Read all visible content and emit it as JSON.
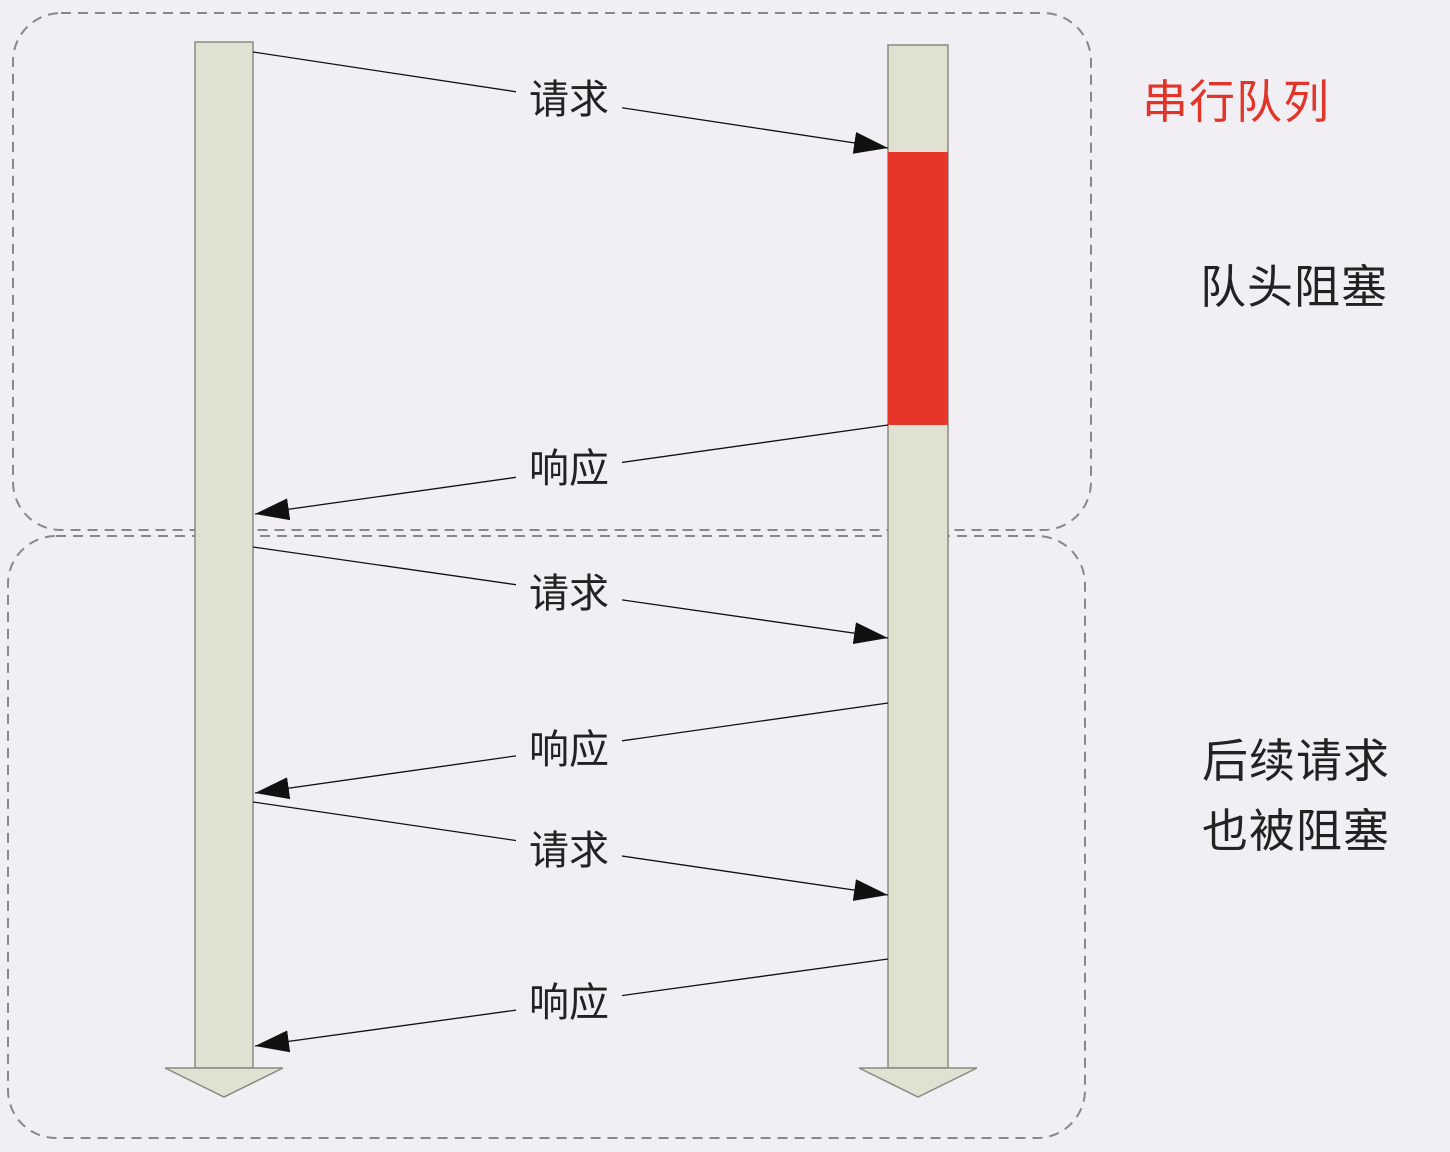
{
  "title": "串行队列",
  "colors": {
    "title": "#e2352a",
    "blocked": "#e8352a",
    "timeline": "#e0e1d1",
    "timeline_border": "#8a8a84",
    "group_border": "#888888",
    "arrow": "#111111",
    "text": "#222222",
    "background": "#f1eff4"
  },
  "groups": [
    {
      "annotation": "队头阻塞"
    },
    {
      "annotation_lines": [
        "后续请求",
        "也被阻塞"
      ]
    }
  ],
  "messages": [
    {
      "label": "请求",
      "direction": "client-to-server"
    },
    {
      "label": "响应",
      "direction": "server-to-client"
    },
    {
      "label": "请求",
      "direction": "client-to-server"
    },
    {
      "label": "响应",
      "direction": "server-to-client"
    },
    {
      "label": "请求",
      "direction": "client-to-server"
    },
    {
      "label": "响应",
      "direction": "server-to-client"
    }
  ]
}
